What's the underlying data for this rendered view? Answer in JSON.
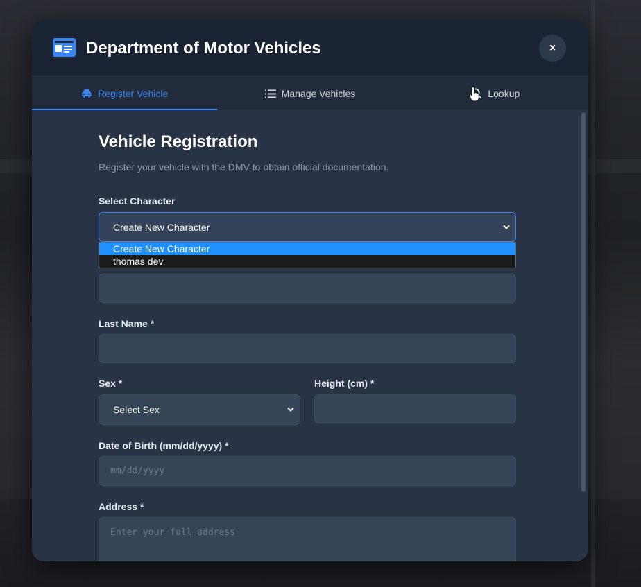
{
  "header": {
    "title": "Department of Motor Vehicles",
    "close_label": "×",
    "logo_icon": "id-card-icon"
  },
  "tabs": [
    {
      "label": "Register Vehicle",
      "icon": "car-icon",
      "active": true
    },
    {
      "label": "Manage Vehicles",
      "icon": "list-icon",
      "active": false
    },
    {
      "label": "Lookup",
      "icon": "search-icon",
      "active": false
    }
  ],
  "form": {
    "title": "Vehicle Registration",
    "subtitle": "Register your vehicle with the DMV to obtain official documentation.",
    "select_character": {
      "label": "Select Character",
      "value": "Create New Character",
      "options": [
        "Create New Character",
        "thomas dev"
      ],
      "highlighted": "Create New Character"
    },
    "last_name": {
      "label": "Last Name *",
      "value": ""
    },
    "sex": {
      "label": "Sex *",
      "value": "Select Sex"
    },
    "height": {
      "label": "Height (cm) *",
      "value": ""
    },
    "dob": {
      "label": "Date of Birth (mm/dd/yyyy) *",
      "placeholder": "mm/dd/yyyy"
    },
    "address": {
      "label": "Address *",
      "placeholder": "Enter your full address"
    }
  },
  "colors": {
    "accent": "#3a86f0",
    "modal_bg": "#283446",
    "header_bg": "#1b2434",
    "dropdown_highlight": "#1e90ff"
  }
}
